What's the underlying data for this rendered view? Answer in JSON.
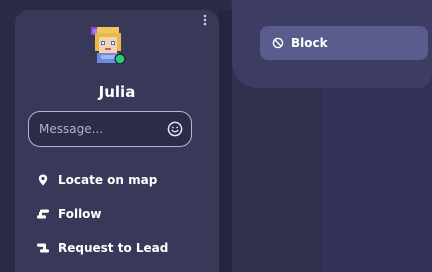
{
  "profile": {
    "name": "Julia",
    "avatar_icon": "pixel-avatar-icon",
    "status_color": "#2ecc71"
  },
  "message": {
    "placeholder": "Message...",
    "emoji_icon": "smiley-icon"
  },
  "actions": [
    {
      "label": "Locate on map",
      "icon": "map-pin-icon"
    },
    {
      "label": "Follow",
      "icon": "follow-icon"
    },
    {
      "label": "Request to Lead",
      "icon": "lead-icon"
    }
  ],
  "menu": {
    "block_label": "Block",
    "block_icon": "block-icon"
  },
  "colors": {
    "background": "#2b2b47",
    "panel": "#383859",
    "menu": "#3d3d63",
    "block_button": "#5a5c8c",
    "input_border": "#b3b5d8"
  }
}
